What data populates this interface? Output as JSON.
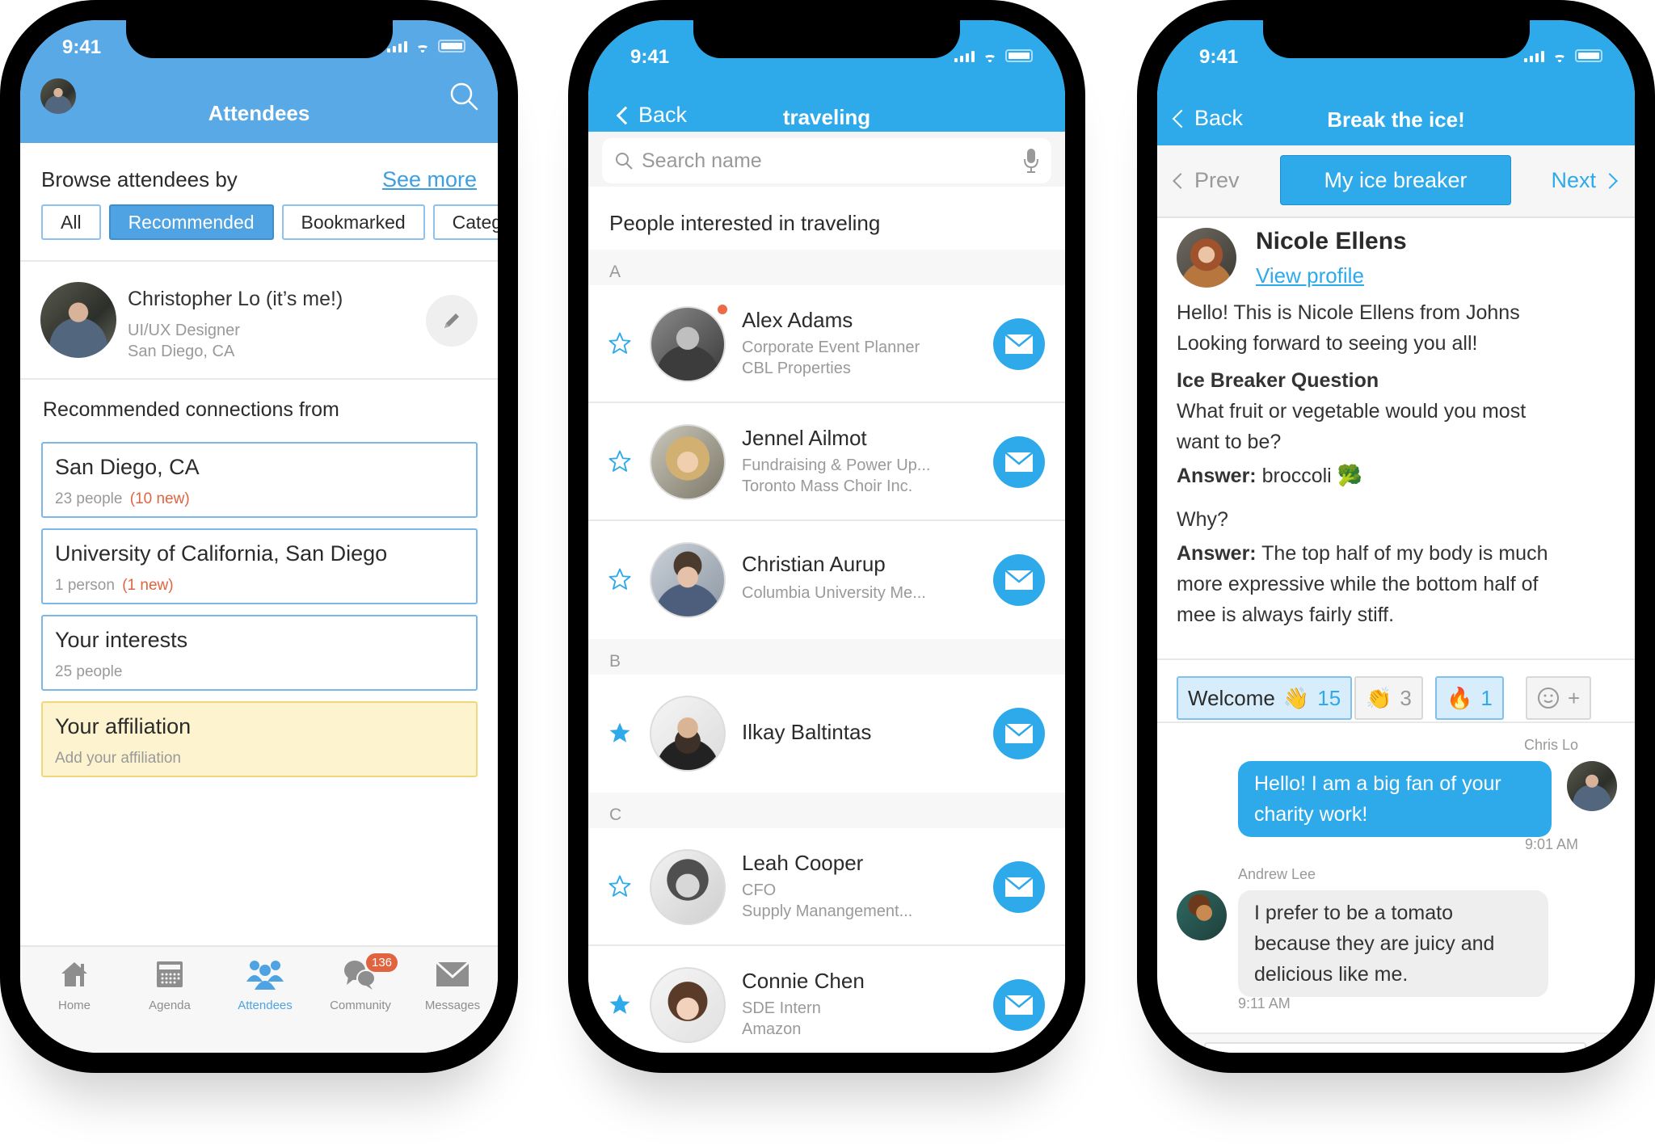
{
  "status_bar": {
    "time": "9:41"
  },
  "phone1": {
    "header": {
      "title": "Attendees"
    },
    "browse": {
      "label": "Browse attendees by",
      "see_more": "See more",
      "chips": [
        {
          "label": "All",
          "active": false
        },
        {
          "label": "Recommended",
          "active": true
        },
        {
          "label": "Bookmarked",
          "active": false
        },
        {
          "label": "Categ",
          "active": false
        }
      ]
    },
    "me": {
      "name": "Christopher Lo (it’s me!)",
      "title": "UI/UX Designer",
      "location": "San Diego, CA"
    },
    "recommended": {
      "title": "Recommended connections from",
      "cards": [
        {
          "title": "San Diego, CA",
          "count": "23 people",
          "new": "(10 new)"
        },
        {
          "title": "University of California, San Diego",
          "count": "1 person",
          "new": "(1 new)"
        },
        {
          "title": "Your interests",
          "count": "25 people",
          "new": ""
        },
        {
          "title": "Your affiliation",
          "count": "Add your affiliation",
          "new": ""
        }
      ]
    },
    "tabbar": {
      "tabs": [
        {
          "label": "Home",
          "icon": "home-icon"
        },
        {
          "label": "Agenda",
          "icon": "calendar-icon"
        },
        {
          "label": "Attendees",
          "icon": "people-icon",
          "active": true
        },
        {
          "label": "Community",
          "icon": "chat-bubbles-icon",
          "badge": "136"
        },
        {
          "label": "Messages",
          "icon": "envelope-icon"
        }
      ]
    }
  },
  "phone2": {
    "header": {
      "back": "Back",
      "title": "traveling"
    },
    "search": {
      "placeholder": "Search name",
      "value": ""
    },
    "list_title": "People interested in traveling",
    "sections": [
      {
        "letter": "A",
        "people": [
          {
            "name": "Alex Adams",
            "line1": "Corporate Event Planner",
            "line2": "CBL Properties",
            "starred": false,
            "online": true
          },
          {
            "name": "Jennel Ailmot",
            "line1": "Fundraising & Power Up...",
            "line2": "Toronto Mass Choir Inc.",
            "starred": false
          },
          {
            "name": "Christian Aurup",
            "line1": "Columbia University Me...",
            "line2": "",
            "starred": false
          }
        ]
      },
      {
        "letter": "B",
        "people": [
          {
            "name": "Ilkay Baltintas",
            "line1": "",
            "line2": "",
            "starred": true
          }
        ]
      },
      {
        "letter": "C",
        "people": [
          {
            "name": "Leah Cooper",
            "line1": "CFO",
            "line2": "Supply Manangement...",
            "starred": false
          },
          {
            "name": "Connie Chen",
            "line1": "SDE Intern",
            "line2": "Amazon",
            "starred": true
          }
        ]
      }
    ]
  },
  "phone3": {
    "header": {
      "back": "Back",
      "title": "Break the ice!"
    },
    "pager": {
      "prev": "Prev",
      "current": "My ice breaker",
      "next": "Next"
    },
    "profile": {
      "name": "Nicole Ellens",
      "view_profile": "View profile"
    },
    "intro": [
      "Hello! This is Nicole Ellens from Johns",
      "Looking forward to seeing you all!"
    ],
    "question_heading": "Ice Breaker Question",
    "question": [
      "What fruit or vegetable would you most",
      "want to be?"
    ],
    "answer_label": "Answer:",
    "answer": "broccoli",
    "answer_emoji": "🥦",
    "why": "Why?",
    "why_answer": [
      "The top half of my body is much",
      "more expressive while the bottom half of",
      "mee is always fairly stiff."
    ],
    "reactions": [
      {
        "label": "Welcome",
        "emoji": "👋",
        "count": "15",
        "active": true
      },
      {
        "label": "",
        "emoji": "👏",
        "count": "3",
        "active": false
      },
      {
        "label": "",
        "emoji": "🔥",
        "count": "1",
        "active": true
      },
      {
        "label": "",
        "emoji": "",
        "count": "",
        "active": false,
        "add": "+"
      }
    ],
    "messages": [
      {
        "sender": "Chris Lo",
        "lines": [
          "Hello!  I am a big fan of your",
          "charity work!"
        ],
        "time": "9:01 AM",
        "mine": true
      },
      {
        "sender": "Andrew Lee",
        "lines": [
          "I prefer to be a tomato",
          "because they are juicy and",
          "delicious like me."
        ],
        "time": "9:11 AM",
        "mine": false
      }
    ]
  }
}
